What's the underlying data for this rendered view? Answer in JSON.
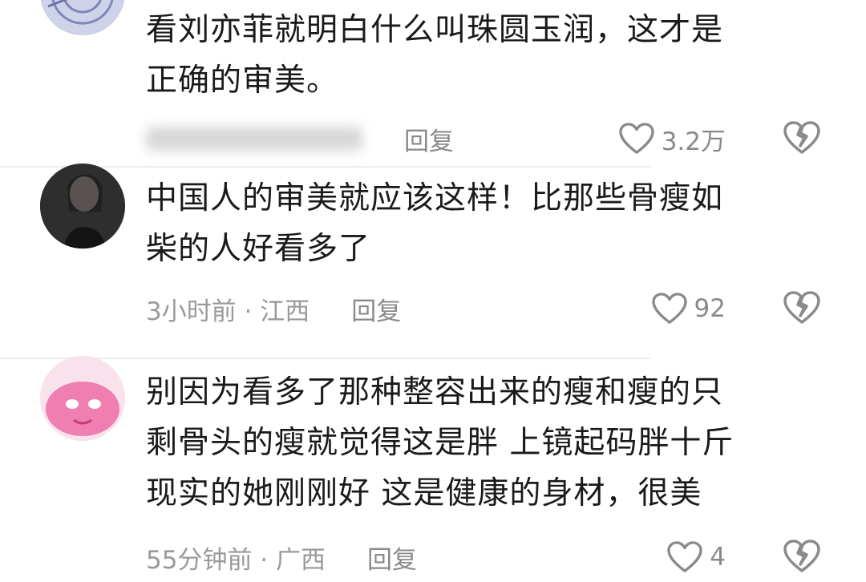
{
  "comments": [
    {
      "text_lines": [
        "看刘亦菲就明白什么叫珠圆玉润，这才是",
        "正确的审美。"
      ],
      "meta": "",
      "reply_label": "回复",
      "likes": "3.2万"
    },
    {
      "text_lines": [
        "中国人的审美就应该这样！比那些骨瘦如",
        "柴的人好看多了"
      ],
      "meta": "3小时前 · 江西",
      "reply_label": "回复",
      "likes": "92"
    },
    {
      "text_lines": [
        "别因为看多了那种整容出来的瘦和瘦的只",
        "剩骨头的瘦就觉得这是胖 上镜起码胖十斤",
        "现实的她刚刚好 这是健康的身材，很美"
      ],
      "meta": "55分钟前 · 广西",
      "reply_label": "回复",
      "likes": "4"
    }
  ],
  "colors": {
    "text": "#1a1a1a",
    "meta": "#9a9a9a",
    "divider": "#ececec"
  }
}
